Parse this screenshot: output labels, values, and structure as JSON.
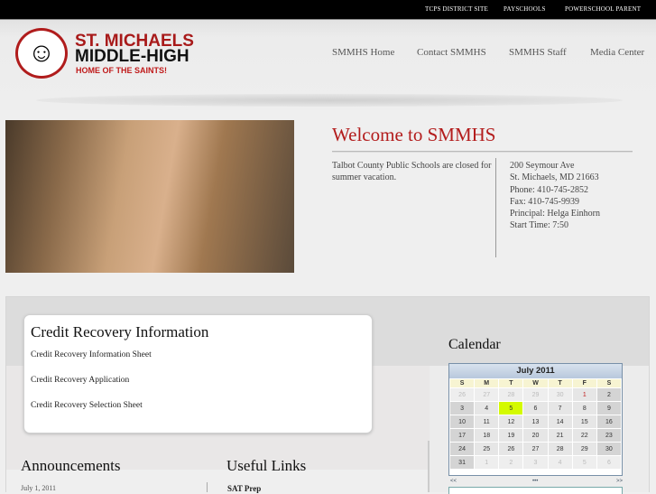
{
  "topbar": {
    "links": [
      "TCPS DISTRICT SITE",
      "PAYSCHOOLS",
      "POWERSCHOOL PARENT"
    ]
  },
  "logo": {
    "line1": "ST. MICHAELS",
    "line2": "MIDDLE-HIGH",
    "tagline": "HOME OF THE SAINTS!"
  },
  "nav": [
    "SMMHS Home",
    "Contact SMMHS",
    "SMMHS Staff",
    "Media Center"
  ],
  "welcome": {
    "title": "Welcome to SMMHS",
    "notice": "Talbot County Public Schools are closed for summer vacation.",
    "address": [
      "200 Seymour Ave",
      "St. Michaels, MD 21663",
      "Phone: 410-745-2852",
      "Fax: 410-745-9939",
      "Principal: Helga Einhorn",
      "Start Time: 7:50"
    ]
  },
  "credit": {
    "title": "Credit Recovery Information",
    "links": [
      "Credit Recovery Information Sheet",
      "Credit Recovery Application",
      "Credit Recovery Selection Sheet"
    ]
  },
  "announcements": {
    "title": "Announcements",
    "date": "July 1, 2011"
  },
  "useful_links": {
    "title": "Useful Links",
    "first": "SAT Prep"
  },
  "calendar": {
    "heading": "Calendar",
    "month": "July 2011",
    "days": [
      "S",
      "M",
      "T",
      "W",
      "T",
      "F",
      "S"
    ],
    "weeks": [
      [
        "26",
        "27",
        "28",
        "29",
        "30",
        "1",
        "2"
      ],
      [
        "3",
        "4",
        "5",
        "6",
        "7",
        "8",
        "9"
      ],
      [
        "10",
        "11",
        "12",
        "13",
        "14",
        "15",
        "16"
      ],
      [
        "17",
        "18",
        "19",
        "20",
        "21",
        "22",
        "23"
      ],
      [
        "24",
        "25",
        "26",
        "27",
        "28",
        "29",
        "30"
      ],
      [
        "31",
        "1",
        "2",
        "3",
        "4",
        "5",
        "6"
      ]
    ],
    "prev": "<<",
    "today": "•••",
    "next": ">>",
    "today_date": "5",
    "accent": "#d4fa00"
  }
}
